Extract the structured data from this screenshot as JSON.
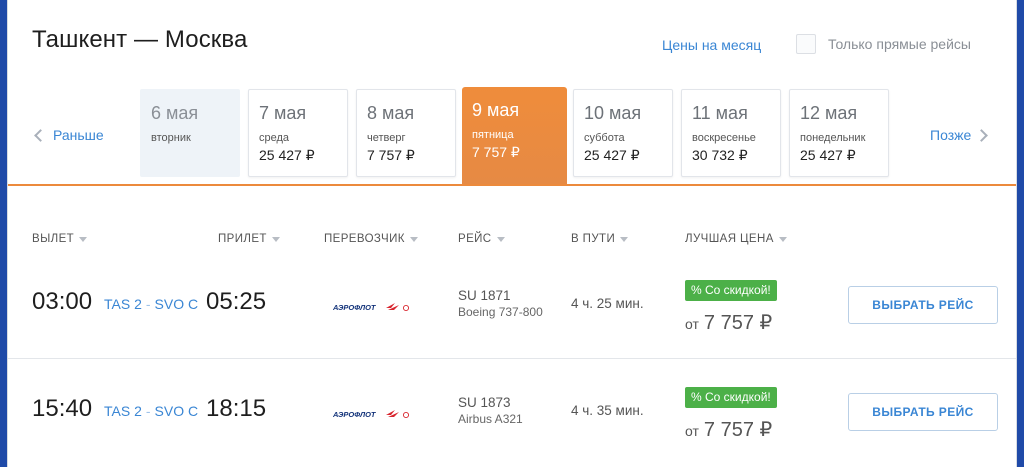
{
  "header": {
    "title": "Ташкент — Москва",
    "month_prices_link": "Цены на месяц",
    "direct_only_label": "Только прямые рейсы"
  },
  "date_nav": {
    "prev_label": "Раньше",
    "next_label": "Позже",
    "days": [
      {
        "date": "6 мая",
        "weekday": "вторник",
        "price": "",
        "state": "disabled"
      },
      {
        "date": "7 мая",
        "weekday": "среда",
        "price": "25 427 ₽",
        "state": "normal"
      },
      {
        "date": "8 мая",
        "weekday": "четверг",
        "price": "7 757 ₽",
        "state": "normal"
      },
      {
        "date": "9 мая",
        "weekday": "пятница",
        "price": "7 757 ₽",
        "state": "active"
      },
      {
        "date": "10 мая",
        "weekday": "суббота",
        "price": "25 427 ₽",
        "state": "normal"
      },
      {
        "date": "11 мая",
        "weekday": "воскресенье",
        "price": "30 732 ₽",
        "state": "normal"
      },
      {
        "date": "12 мая",
        "weekday": "понедельник",
        "price": "25 427 ₽",
        "state": "normal"
      }
    ]
  },
  "columns": {
    "departure": "ВЫЛЕТ",
    "arrival": "ПРИЛЕТ",
    "carrier": "ПЕРЕВОЗЧИК",
    "flight": "РЕЙС",
    "duration": "В ПУТИ",
    "best_price": "ЛУЧШАЯ ЦЕНА"
  },
  "flights": [
    {
      "dep_time": "03:00",
      "dep_airport": "TAS 2",
      "arr_airport": "SVO C",
      "arr_time": "05:25",
      "carrier_logo_text": "АЭРОФЛОТ",
      "flight_no": "SU 1871",
      "aircraft": "Boeing 737-800",
      "duration": "4 ч. 25 мин.",
      "badge": "% Со скидкой!",
      "price_prefix": "от",
      "price": "7 757 ₽",
      "button": "ВЫБРАТЬ РЕЙС"
    },
    {
      "dep_time": "15:40",
      "dep_airport": "TAS 2",
      "arr_airport": "SVO C",
      "arr_time": "18:15",
      "carrier_logo_text": "АЭРОФЛОТ",
      "flight_no": "SU 1873",
      "aircraft": "Airbus A321",
      "duration": "4 ч. 35 мин.",
      "badge": "% Со скидкой!",
      "price_prefix": "от",
      "price": "7 757 ₽",
      "button": "ВЫБРАТЬ РЕЙС"
    }
  ],
  "colors": {
    "accent_orange": "#ec8a3c",
    "link_blue": "#3a86d4",
    "discount_green": "#4cb048",
    "aeroflot_red": "#d8262f",
    "aeroflot_navy": "#13337a"
  }
}
